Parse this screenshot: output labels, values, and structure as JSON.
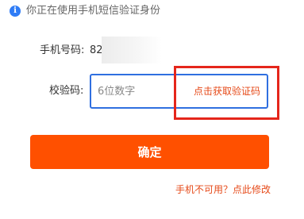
{
  "notice": {
    "icon": "info-icon",
    "icon_glyph": "i",
    "text": "你正在使用手机短信验证身份"
  },
  "phone": {
    "label": "手机号码:",
    "value": "82"
  },
  "code": {
    "label": "校验码:",
    "placeholder": "6位数字",
    "get_code_label": "点击获取验证码"
  },
  "confirm_button": {
    "label": "确定"
  },
  "unavailable_link": {
    "label": "手机不可用？点此修改"
  },
  "colors": {
    "accent": "#ff5000",
    "link": "#e64a19",
    "info_icon": "#2f7cf6",
    "input_border": "#2f6fe0",
    "highlight": "#e5261b"
  }
}
